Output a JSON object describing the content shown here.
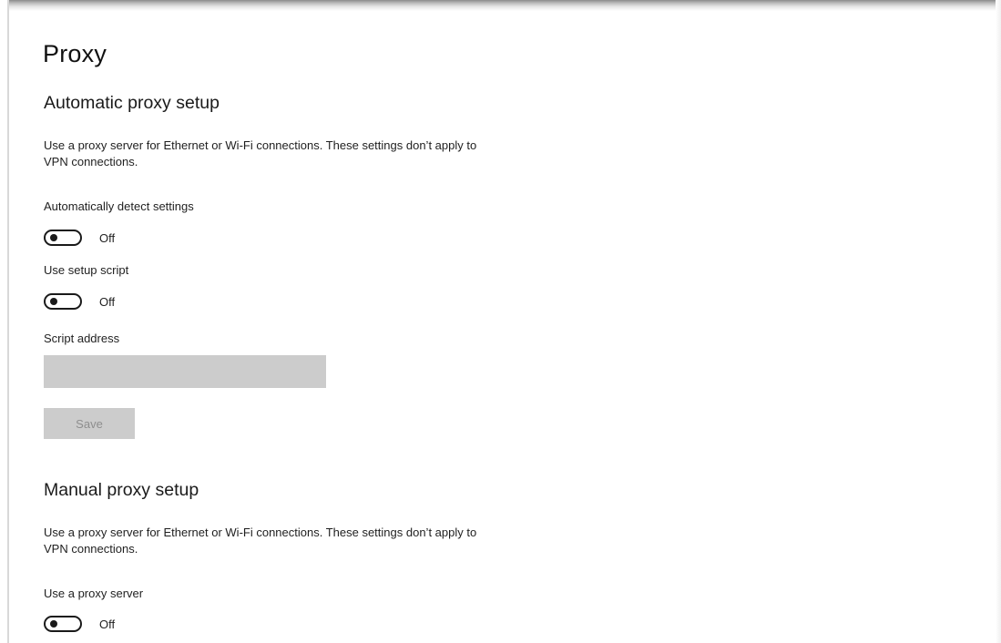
{
  "page": {
    "title": "Proxy"
  },
  "automatic": {
    "heading": "Automatic proxy setup",
    "description": "Use a proxy server for Ethernet or Wi-Fi connections. These settings don’t apply to VPN connections.",
    "detect_settings": {
      "label": "Automatically detect settings",
      "state": "Off"
    },
    "setup_script": {
      "label": "Use setup script",
      "state": "Off"
    },
    "script_address": {
      "label": "Script address",
      "value": ""
    },
    "save_label": "Save"
  },
  "manual": {
    "heading": "Manual proxy setup",
    "description": "Use a proxy server for Ethernet or Wi-Fi connections. These settings don’t apply to VPN connections.",
    "use_proxy": {
      "label": "Use a proxy server",
      "state": "Off"
    }
  },
  "colors": {
    "disabled_fill": "#cccccc",
    "disabled_text": "#8e8e8e",
    "toggle_stroke": "#1a1a1a"
  }
}
